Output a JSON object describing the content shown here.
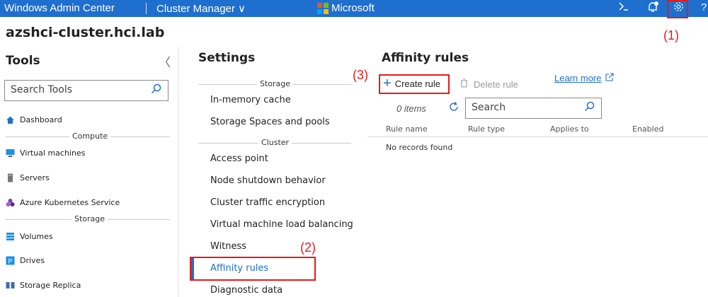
{
  "topbar": {
    "app_title": "Windows Admin Center",
    "context": "Cluster Manager ∨",
    "brand": "Microsoft",
    "brand_colors": [
      "#f25022",
      "#7fba00",
      "#00a4ef",
      "#ffb900"
    ],
    "icons": [
      "terminal-icon",
      "bell-icon",
      "gear-icon",
      "help-icon"
    ],
    "help_glyph": "?"
  },
  "page_title": "azshci-cluster.hci.lab",
  "tools": {
    "title": "Tools",
    "collapse_glyph": "〈",
    "search_placeholder": "Search Tools",
    "dashboard": "Dashboard",
    "group_compute": "Compute",
    "virtual_machines": "Virtual machines",
    "servers": "Servers",
    "aks": "Azure Kubernetes Service",
    "group_storage": "Storage",
    "volumes": "Volumes",
    "drives": "Drives",
    "storage_replica": "Storage Replica"
  },
  "settings": {
    "title": "Settings",
    "group_storage": "Storage",
    "in_memory_cache": "In-memory cache",
    "storage_spaces": "Storage Spaces and pools",
    "group_cluster": "Cluster",
    "access_point": "Access point",
    "node_shutdown": "Node shutdown behavior",
    "traffic_encryption": "Cluster traffic encryption",
    "vm_load_balancing": "Virtual machine load balancing",
    "witness": "Witness",
    "affinity_rules": "Affinity rules",
    "diagnostic_data": "Diagnostic data"
  },
  "affinity": {
    "title": "Affinity rules",
    "create_rule": "Create rule",
    "delete_rule": "Delete rule",
    "learn_more": "Learn more",
    "item_count": "0 items",
    "search_placeholder": "Search",
    "columns": [
      "Rule name",
      "Rule type",
      "Applies to",
      "Enabled"
    ],
    "empty_message": "No records found"
  },
  "annotations": {
    "label_1": "(1)",
    "label_2": "(2)",
    "label_3": "(3)",
    "color": "#e41b1b"
  },
  "accent_color": "#1f6fce"
}
